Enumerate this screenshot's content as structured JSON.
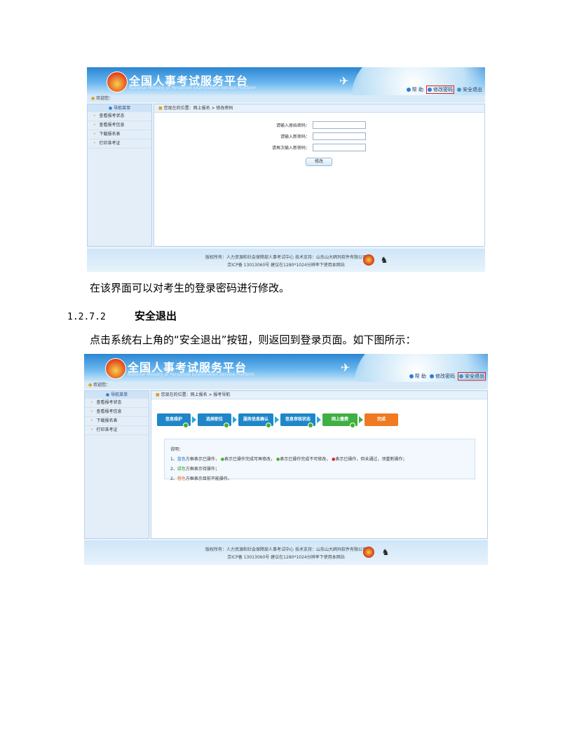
{
  "screenshot1": {
    "platform_title": "全国人事考试服务平台",
    "platform_subtitle": "National Ministry of Personnel Examination Service Platform",
    "logo_text": "PTA",
    "toplinks": {
      "help": "帮 助",
      "change_pwd": "修改密码",
      "logout": "安全退出"
    },
    "welcome": "欢迎您：",
    "nav_header": "导航菜单",
    "nav_items": [
      "查看报考状态",
      "查看报考信息",
      "下载报名表",
      "打印准考证"
    ],
    "breadcrumb": "您现在的位置：网上报名  >  修改密码",
    "form": {
      "old_pwd": "请输入原始密码：",
      "new_pwd": "请输入新密码：",
      "confirm_pwd": "请再次输入新密码：",
      "submit": "修改"
    },
    "footer_line1": "版权所有：人力资源和社会保障部人事考试中心  技术支持：山东山大鸥玛软件有限公司",
    "footer_line2": "京ICP备 13013060号  建议在1280*1024分辨率下使用本网站"
  },
  "caption1": "在该界面可以对考生的登录密码进行修改。",
  "section": {
    "number": "1.2.7.2",
    "title": "安全退出"
  },
  "caption2": "点击系统右上角的“安全退出”按钮，则返回到登录页面。如下图所示：",
  "screenshot2": {
    "platform_title": "全国人事考试服务平台",
    "platform_subtitle": "National Ministry of Personnel Examination Service Platform",
    "logo_text": "PTA",
    "toplinks": {
      "help": "帮 助",
      "change_pwd": "修改密码",
      "logout": "安全退出"
    },
    "welcome": "欢迎您：",
    "nav_header": "导航菜单",
    "nav_items": [
      "查看报考状态",
      "查看报考信息",
      "下载报名表",
      "打印准考证"
    ],
    "breadcrumb": "您现在的位置：网上报名  >  报考导航",
    "steps": [
      "信息维护",
      "选择职位",
      "服务信息确认",
      "信息审核状态",
      "网上缴费",
      "完成"
    ],
    "notes": {
      "title": "说明：",
      "line1_a": "1、",
      "line1_b": "蓝色",
      "line1_c": "方框表示已操作，",
      "line1_d": "表示已操作完成可再修改，",
      "line1_e": "表示已操作完成不可修改，",
      "line1_f": "表示已操作，但未通过，须重新操作；",
      "line2_a": "2、",
      "line2_b": "绿色",
      "line2_c": "方框表示待操作；",
      "line3_a": "2、",
      "line3_b": "橙色",
      "line3_c": "方框表示目前不能操作。"
    },
    "footer_line1": "版权所有：人力资源和社会保障部人事考试中心  技术支持：山东山大鸥玛软件有限公司",
    "footer_line2": "京ICP备 13013060号  建议在1280*1024分辨率下使用本网站"
  }
}
